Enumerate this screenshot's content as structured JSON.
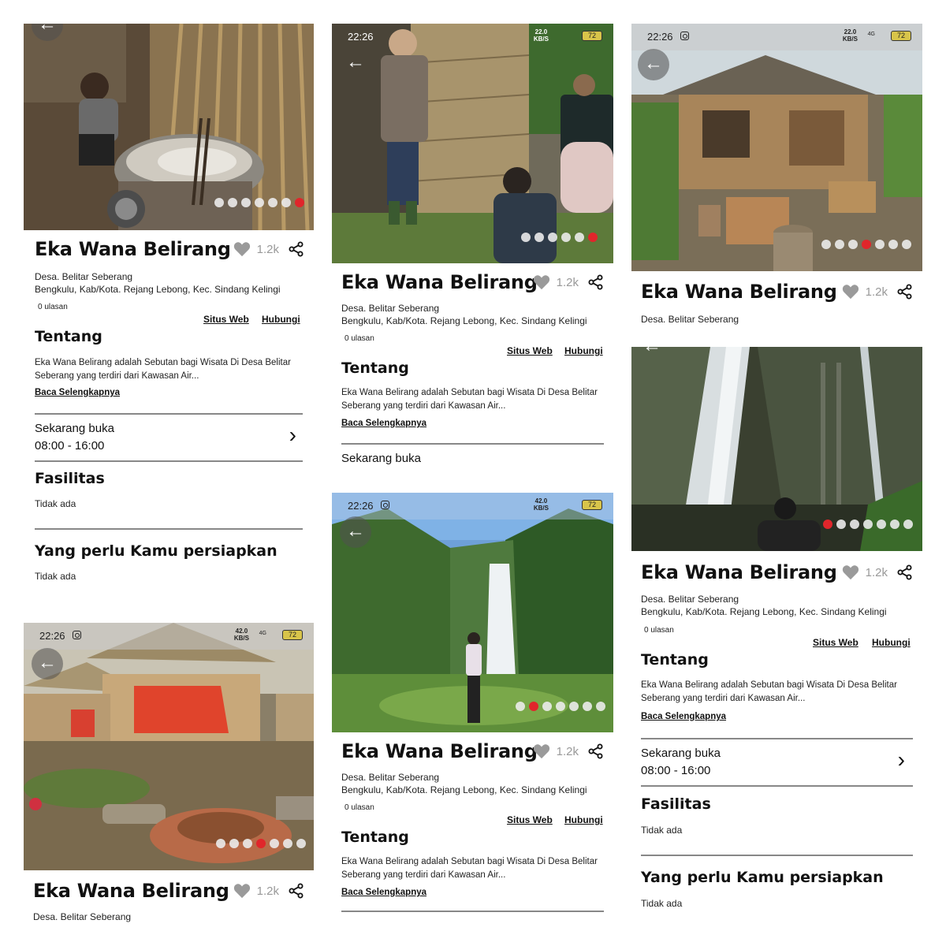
{
  "status": {
    "time": "22:26",
    "speed_value": "42.0",
    "speed_unit": "KB/S",
    "speed_value_alt": "22.0",
    "network": "4G",
    "battery": "72"
  },
  "place": {
    "title": "Eka Wana Belirang",
    "likes": "1.2k",
    "address_line1": "Desa. Belitar Seberang",
    "address_line2": "Bengkulu, Kab/Kota. Rejang Lebong, Kec. Sindang Kelingi",
    "reviews": "0 ulasan",
    "website_label": "Situs Web",
    "contact_label": "Hubungi"
  },
  "about": {
    "heading": "Tentang",
    "text": "Eka Wana Belirang adalah Sebutan bagi Wisata Di Desa Belitar Seberang yang terdiri dari Kawasan Air...",
    "read_more": "Baca Selengkapnya"
  },
  "hours": {
    "status": "Sekarang buka",
    "range": "08:00 - 16:00"
  },
  "facilities": {
    "heading": "Fasilitas",
    "value": "Tidak ada"
  },
  "prepare": {
    "heading": "Yang perlu Kamu persiapkan",
    "value": "Tidak ada"
  },
  "icons": {
    "back": "back-arrow-icon",
    "heart": "heart-icon",
    "share": "share-icon",
    "chevron": "chevron-right-icon"
  },
  "colors": {
    "accent_dot": "#e0262b",
    "like_gray": "#999999",
    "text": "#111111"
  }
}
